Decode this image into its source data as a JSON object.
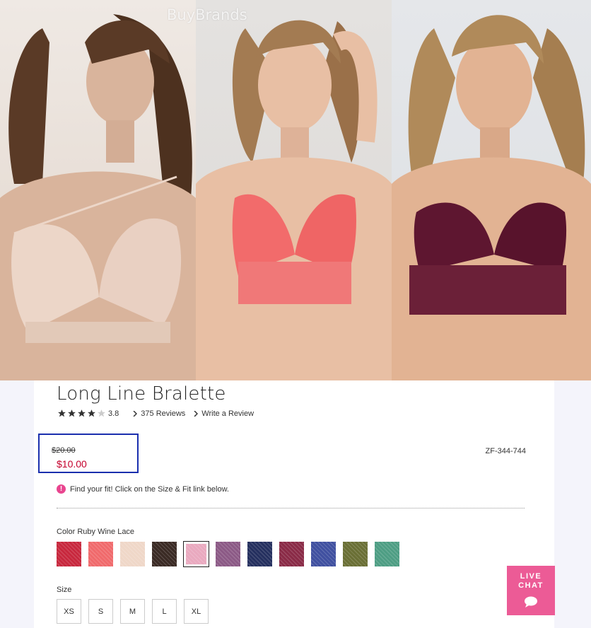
{
  "watermark": "BuyBrands",
  "hero": {
    "models": [
      {
        "skin": "#d9b49c",
        "hair": "#5a3a26",
        "bra": "#ecd6c8"
      },
      {
        "skin": "#e8bfa4",
        "hair": "#a37b52",
        "bra": "#f26b6b"
      },
      {
        "skin": "#e2b393",
        "hair": "#b08a5a",
        "bra": "#5e1630"
      }
    ]
  },
  "product": {
    "title": "Long Line Bralette",
    "rating": {
      "stars": 3.8,
      "score": "3.8"
    },
    "reviews_link": "375 Reviews",
    "write_review_link": "Write a Review",
    "old_price": "$20.00",
    "new_price": "$10.00",
    "sku": "ZF-344-744",
    "fit_note": "Find your fit! Click on the Size & Fit link below.",
    "fit_icon": "!",
    "color_label": "Color Ruby Wine Lace",
    "swatches": [
      {
        "name": "crimson",
        "color": "#c8283e"
      },
      {
        "name": "coral",
        "color": "#f06a6c"
      },
      {
        "name": "nude",
        "color": "#efd7c8"
      },
      {
        "name": "black-lace",
        "color": "#3a2a24"
      },
      {
        "name": "ruby-wine-lace",
        "color": "#e9a9bf",
        "selected": true
      },
      {
        "name": "mauve",
        "color": "#8c5a86"
      },
      {
        "name": "navy",
        "color": "#25305f"
      },
      {
        "name": "floral-wine",
        "color": "#8a2b47"
      },
      {
        "name": "blue-print",
        "color": "#4050a0"
      },
      {
        "name": "olive",
        "color": "#6a6f35"
      },
      {
        "name": "mint",
        "color": "#4e9e84"
      }
    ],
    "size_label": "Size",
    "sizes": [
      "XS",
      "S",
      "M",
      "L",
      "XL"
    ]
  },
  "live_chat": {
    "line1": "LIVE",
    "line2": "CHAT",
    "icon": "chat-bubble-icon"
  },
  "colors": {
    "accent": "#ec5b96",
    "sale": "#c4002c",
    "highlight_box": "#1a2fae"
  }
}
